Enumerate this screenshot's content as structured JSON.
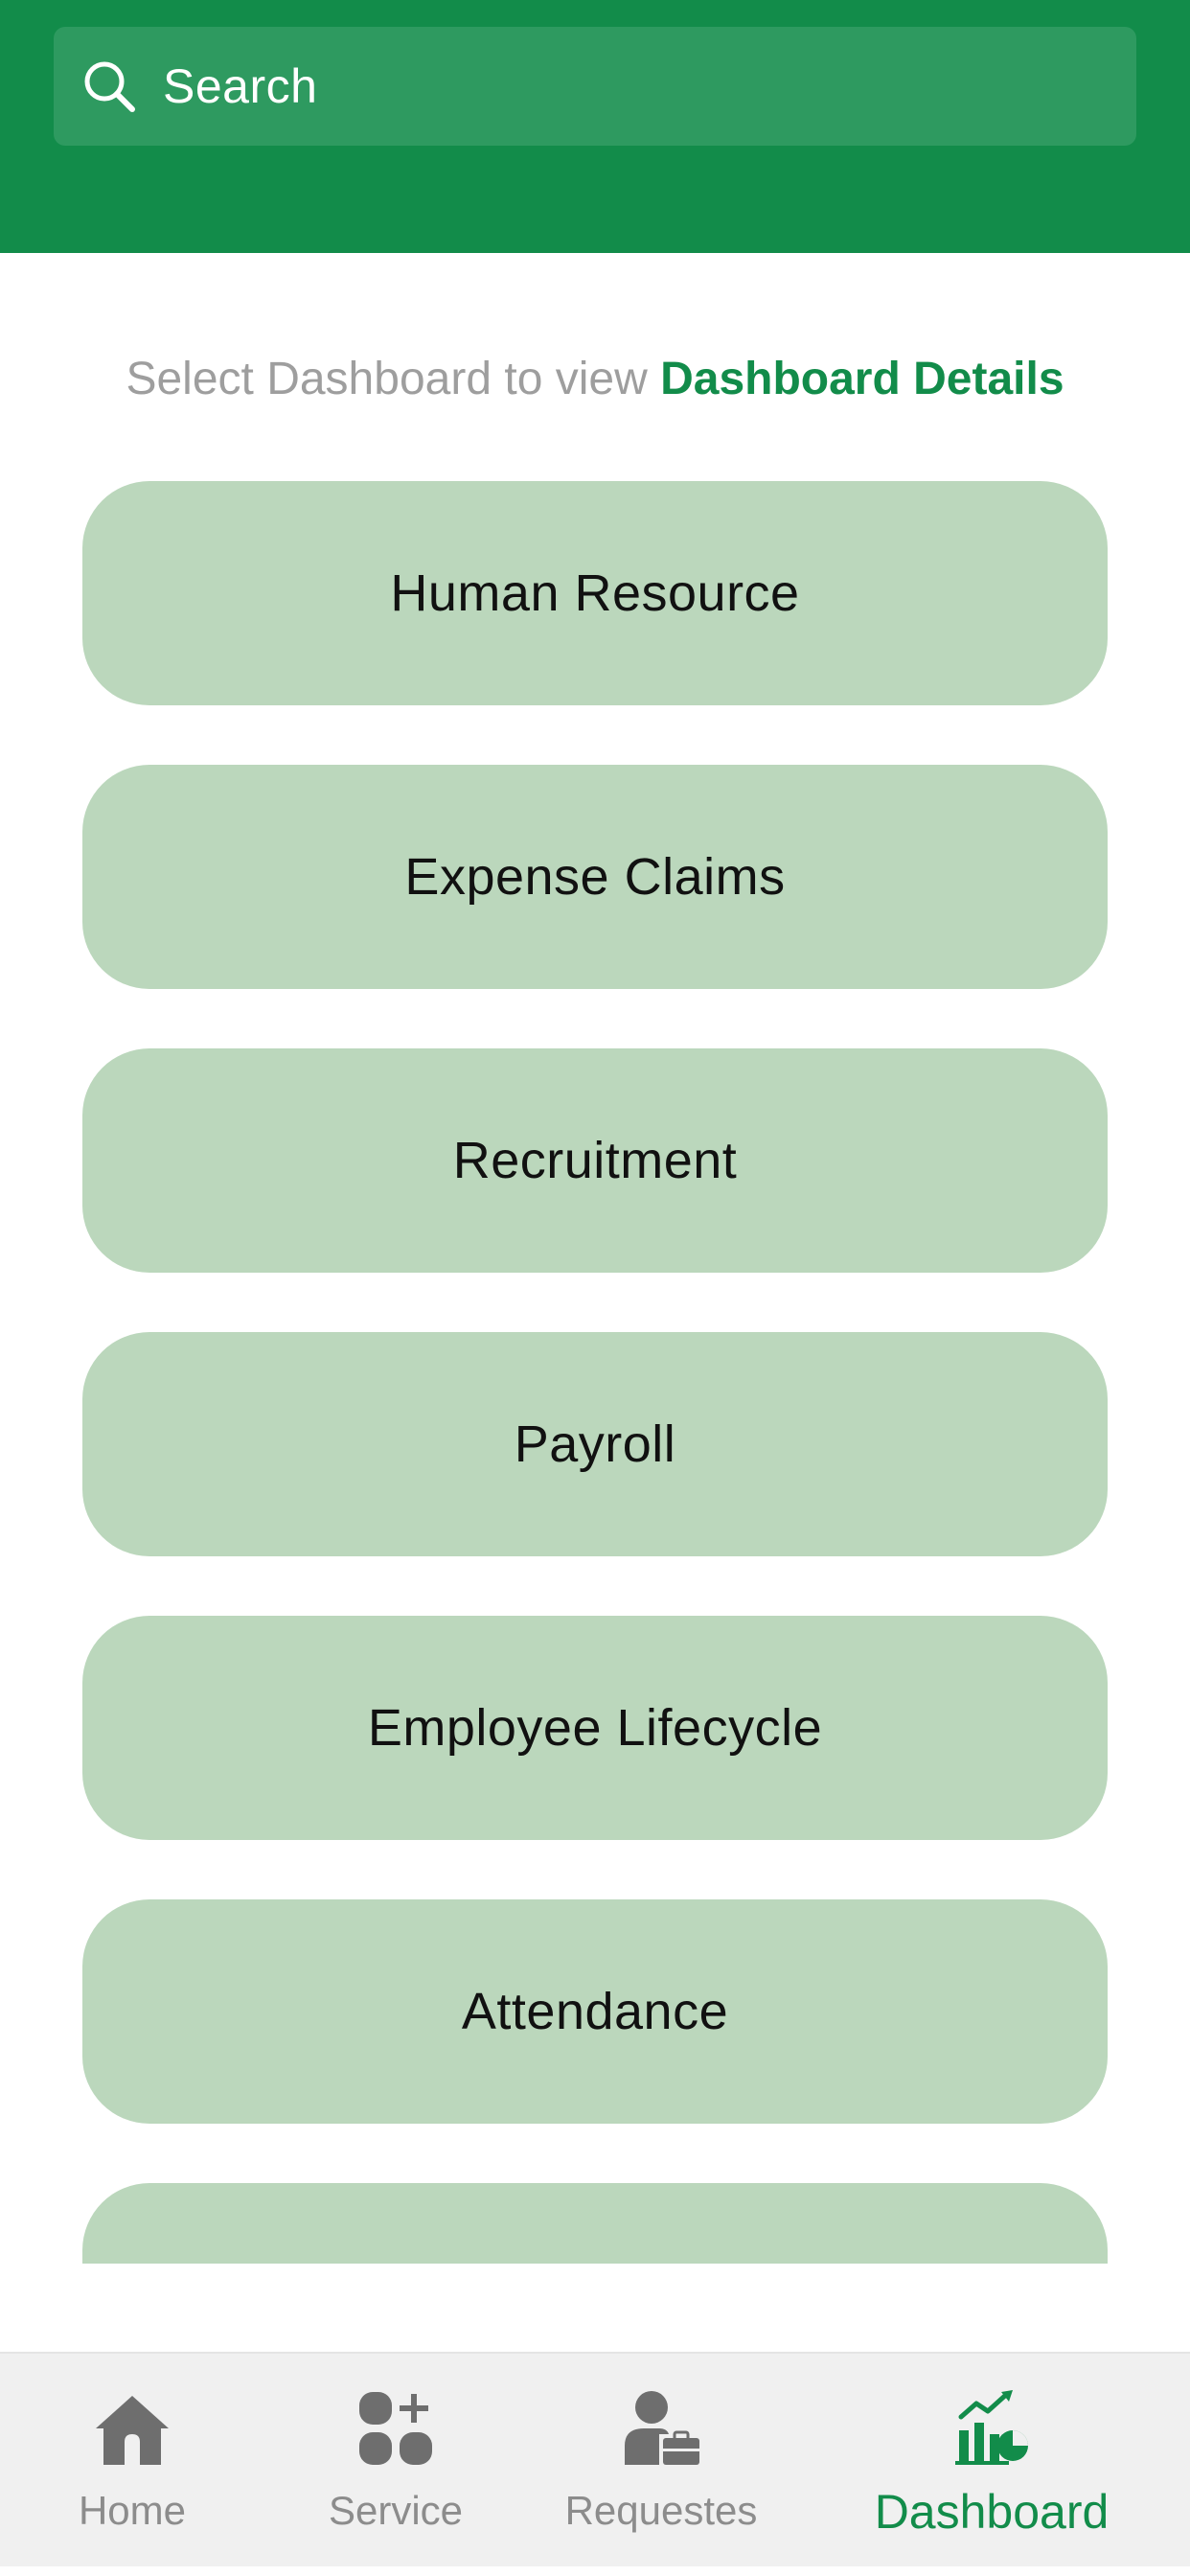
{
  "header": {
    "search": {
      "placeholder": "Search",
      "icon": "search-icon"
    },
    "background_color": "#128c4a"
  },
  "subtitle": {
    "prefix": "Select Dashboard to view ",
    "highlight": "Dashboard Details"
  },
  "dashboards": [
    {
      "label": "Human Resource"
    },
    {
      "label": "Expense Claims"
    },
    {
      "label": "Recruitment"
    },
    {
      "label": "Payroll"
    },
    {
      "label": "Employee Lifecycle"
    },
    {
      "label": "Attendance"
    },
    {
      "label": ""
    }
  ],
  "bottom_nav": {
    "items": [
      {
        "label": "Home",
        "icon": "home-icon",
        "active": false
      },
      {
        "label": "Service",
        "icon": "service-grid-icon",
        "active": false
      },
      {
        "label": "Requestes",
        "icon": "requests-user-briefcase-icon",
        "active": false
      },
      {
        "label": "Dashboard",
        "icon": "dashboard-chart-icon",
        "active": true
      }
    ]
  },
  "colors": {
    "brand_green": "#128c4a",
    "item_background": "#bbd7bc",
    "inactive_nav": "#8c8c8c"
  }
}
